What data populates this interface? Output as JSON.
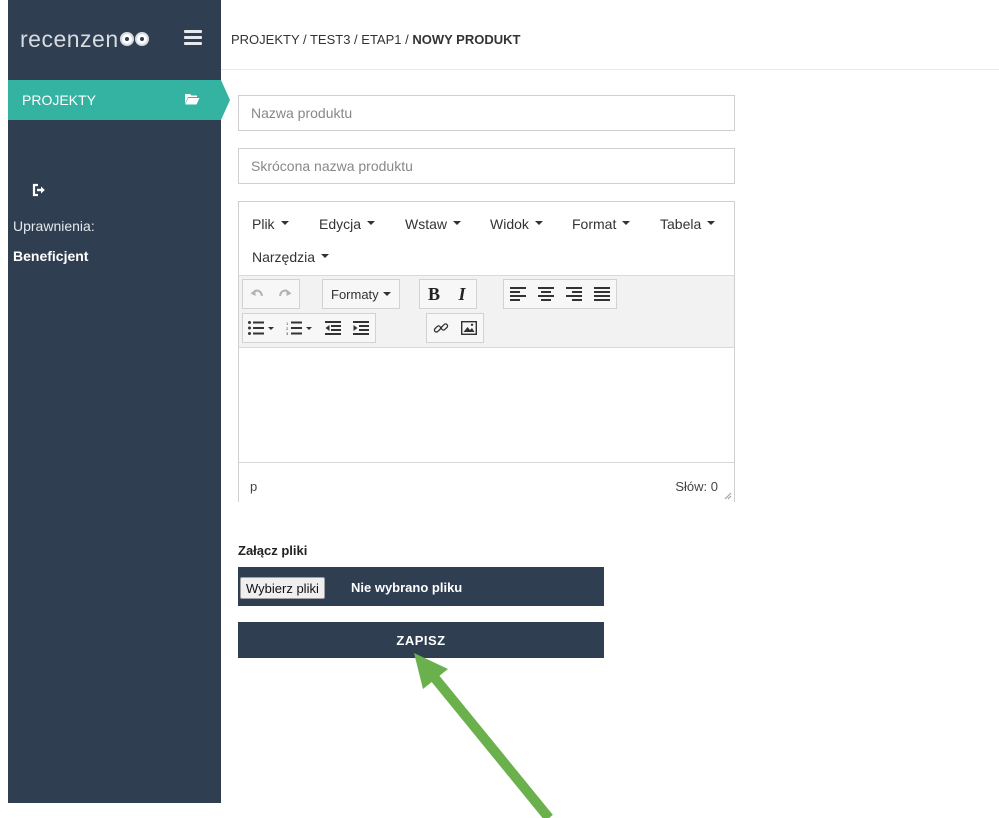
{
  "app": {
    "logo_text": "recenzen",
    "brand_color": "#2f3e50",
    "accent_color": "#34b3a3"
  },
  "sidebar": {
    "items": [
      {
        "label": "PROJEKTY",
        "icon": "folder-open-icon",
        "active": true
      }
    ],
    "logout_icon": "sign-out-icon",
    "permissions_label": "Uprawnienia:",
    "role": "Beneficjent"
  },
  "header": {
    "breadcrumb_path": "PROJEKTY / TEST3 / ETAP1 / ",
    "breadcrumb_current": "NOWY PRODUKT"
  },
  "form": {
    "name_placeholder": "Nazwa produktu",
    "name_value": "",
    "short_name_placeholder": "Skrócona nazwa produktu",
    "short_name_value": "",
    "editor": {
      "menu": [
        "Plik",
        "Edycja",
        "Wstaw",
        "Widok",
        "Format",
        "Tabela",
        "Narzędzia"
      ],
      "formats_label": "Formaty",
      "content": "",
      "path": "p",
      "word_count_label": "Słów: 0"
    },
    "attach_label": "Załącz pliki",
    "file_button_label": "Wybierz pliki",
    "file_status": "Nie wybrano pliku",
    "save_label": "ZAPISZ"
  },
  "annotation": {
    "arrow_color": "#6ab04c"
  }
}
